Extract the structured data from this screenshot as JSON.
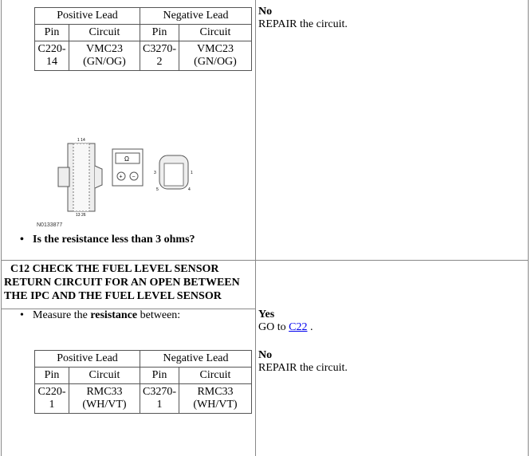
{
  "step_prev": {
    "table": {
      "headers": [
        "Positive Lead",
        "Negative Lead"
      ],
      "sub": [
        "Pin",
        "Circuit",
        "Pin",
        "Circuit"
      ],
      "row": [
        "C220-14",
        "VMC23 (GN/OG)",
        "C3270-2",
        "VMC23 (GN/OG)"
      ]
    },
    "figure_id": "N0133877",
    "figure_labels": {
      "top": "1 14",
      "bottom": "13 26",
      "ohm": "Ω",
      "plus": "+",
      "minus": "−",
      "p3": "3",
      "p1": "1",
      "p5": "5",
      "p4": "4"
    },
    "question": "Is the resistance less than 3 ohms?",
    "no_label": "No",
    "no_action": "REPAIR the circuit."
  },
  "step_c12": {
    "title": "C12 CHECK THE FUEL LEVEL SENSOR RETURN CIRCUIT FOR AN OPEN BETWEEN THE IPC AND THE FUEL LEVEL SENSOR",
    "instruction_pre": "Measure the ",
    "instruction_bold": "resistance",
    "instruction_post": " between:",
    "table": {
      "headers": [
        "Positive Lead",
        "Negative Lead"
      ],
      "sub": [
        "Pin",
        "Circuit",
        "Pin",
        "Circuit"
      ],
      "row": [
        "C220-1",
        "RMC33 (WH/VT)",
        "C3270-1",
        "RMC33 (WH/VT)"
      ]
    },
    "yes_label": "Yes",
    "yes_pre": "GO to ",
    "yes_link": "C22",
    "yes_post": " .",
    "no_label": "No",
    "no_action": "REPAIR the circuit."
  }
}
